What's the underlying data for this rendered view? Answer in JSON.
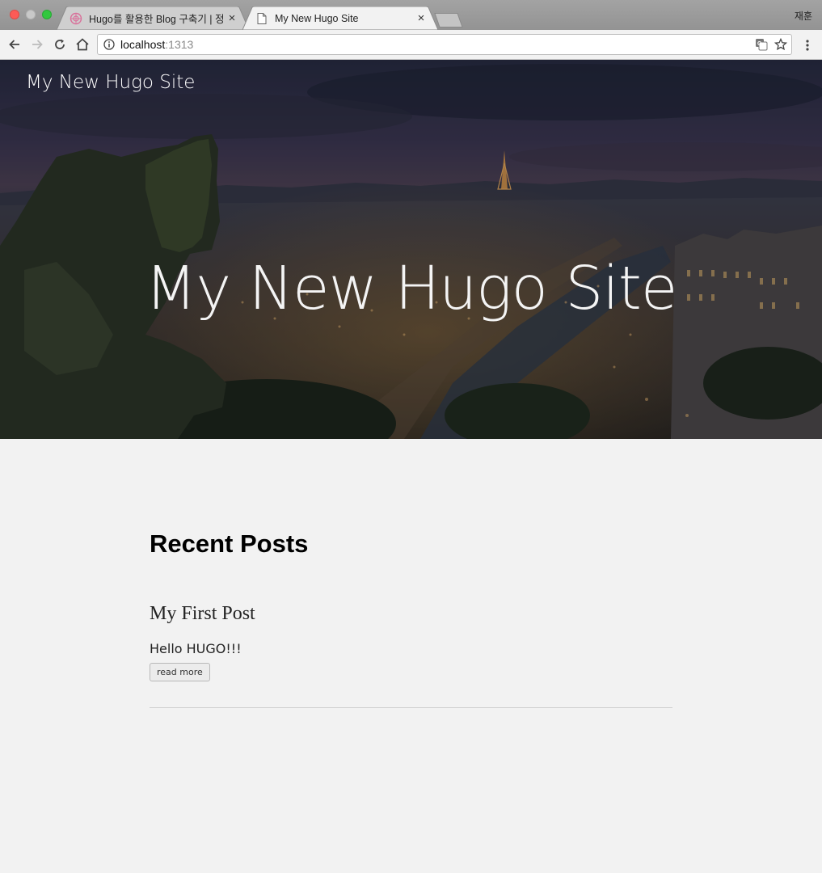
{
  "browser": {
    "tabs": [
      {
        "title": "Hugo를 활용한 Blog 구축기 | 정재",
        "active": false
      },
      {
        "title": "My New Hugo Site",
        "active": true
      }
    ],
    "profile_name": "재훈",
    "url_host": "localhost",
    "url_port": ":1313"
  },
  "site": {
    "brand": "My New Hugo Site",
    "hero_title": "My New Hugo Site"
  },
  "main": {
    "section_title": "Recent Posts",
    "posts": [
      {
        "title": "My First Post",
        "summary": "Hello HUGO!!!",
        "read_more_label": "read more"
      }
    ]
  },
  "colors": {
    "page_background": "#f2f2f2",
    "hero_tint": "#2b3048",
    "text": "#222222"
  }
}
